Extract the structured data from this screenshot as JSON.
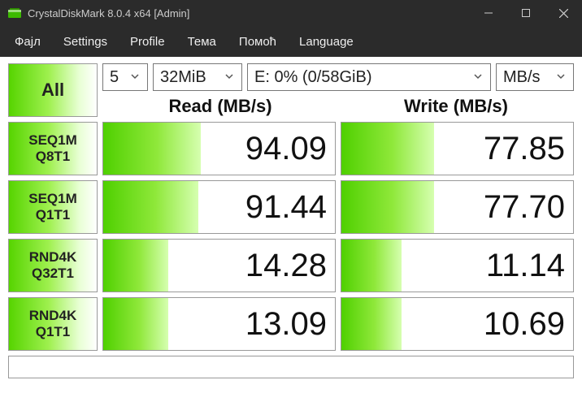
{
  "window": {
    "title": "CrystalDiskMark 8.0.4 x64 [Admin]"
  },
  "menu": {
    "items": [
      "Фајл",
      "Settings",
      "Profile",
      "Тема",
      "Помоћ",
      "Language"
    ]
  },
  "controls": {
    "all_label": "All",
    "count": "5",
    "size": "32MiB",
    "drive": "E: 0% (0/58GiB)",
    "unit": "MB/s"
  },
  "headers": {
    "read": "Read (MB/s)",
    "write": "Write (MB/s)"
  },
  "rows": [
    {
      "label1": "SEQ1M",
      "label2": "Q8T1",
      "read": "94.09",
      "write": "77.85",
      "read_pct": 42,
      "write_pct": 40
    },
    {
      "label1": "SEQ1M",
      "label2": "Q1T1",
      "read": "91.44",
      "write": "77.70",
      "read_pct": 41,
      "write_pct": 40
    },
    {
      "label1": "RND4K",
      "label2": "Q32T1",
      "read": "14.28",
      "write": "11.14",
      "read_pct": 28,
      "write_pct": 26
    },
    {
      "label1": "RND4K",
      "label2": "Q1T1",
      "read": "13.09",
      "write": "10.69",
      "read_pct": 28,
      "write_pct": 26
    }
  ]
}
